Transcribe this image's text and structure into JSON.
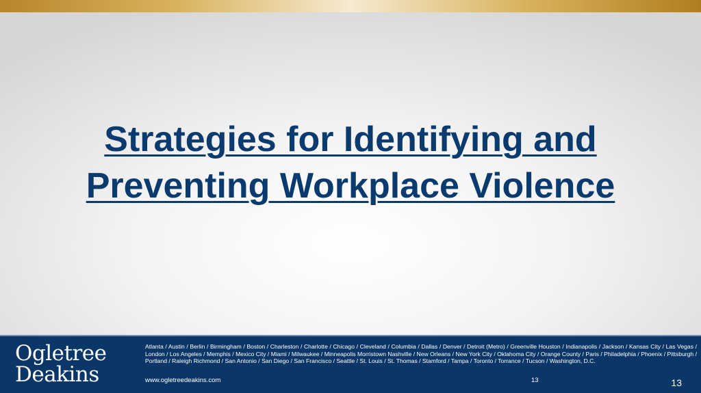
{
  "slide": {
    "title": "Strategies for Identifying and Preventing Workplace Violence",
    "colors": {
      "title": "#0b3a6e",
      "footer_background": "#0b3768",
      "gold_bar": "#d9b25e"
    }
  },
  "footer": {
    "logo_line1": "Ogletree",
    "logo_line2": "Deakins",
    "offices": "Atlanta / Austin / Berlin / Birmingham / Boston / Charleston / Charlotte / Chicago / Cleveland / Columbia / Dallas / Denver / Detroit (Metro) / Greenville Houston / Indianapolis / Jackson / Kansas City / Las Vegas / London / Los Angeles / Memphis / Mexico City / Miami / Milwaukee / Minneapolis Morristown Nashville / New Orleans / New York City / Oklahoma City / Orange County / Paris / Philadelphia / Phoenix / Pittsburgh / Portland / Raleigh Richmond / San Antonio / San Diego / San Francisco / Seattle / St. Louis / St. Thomas / Stamford / Tampa / Toronto / Torrance / Tucson / Washington, D.C.",
    "website": "www.ogletreedeakins.com",
    "page_number_small": "13",
    "page_number_large": "13"
  }
}
